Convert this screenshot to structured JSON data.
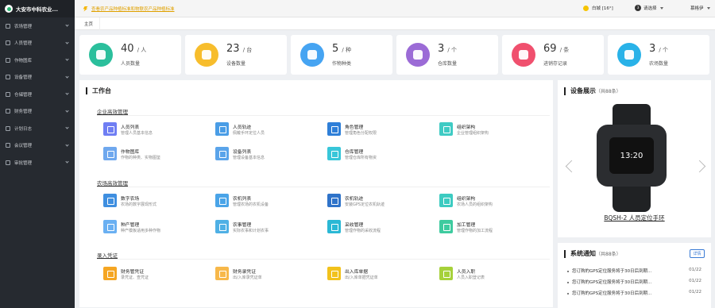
{
  "sidebar": {
    "brand": "大安市中科农业...",
    "items": [
      {
        "label": "农场管理",
        "icon": "farm-icon"
      },
      {
        "label": "人员管理",
        "icon": "people-icon"
      },
      {
        "label": "作物图库",
        "icon": "crop-icon"
      },
      {
        "label": "设备管理",
        "icon": "device-icon"
      },
      {
        "label": "仓储管理",
        "icon": "warehouse-icon"
      },
      {
        "label": "财务管理",
        "icon": "finance-icon"
      },
      {
        "label": "计划日志",
        "icon": "plan-icon"
      },
      {
        "label": "会议管理",
        "icon": "meeting-icon"
      },
      {
        "label": "审批管理",
        "icon": "approval-icon"
      }
    ]
  },
  "topbar": {
    "notice": "查看农产品种植标准和物联农产品种植标准",
    "weather": "白城 [16°]",
    "choose_num": "3",
    "choose_label": "请选择",
    "user": "慕格伊"
  },
  "tabs": [
    "主页"
  ],
  "stats": [
    {
      "value": "40",
      "unit": "/ 人",
      "label": "人员数量",
      "color": "#2bbf9c",
      "icon": "person-icon"
    },
    {
      "value": "23",
      "unit": "/ 台",
      "label": "设备数量",
      "color": "#f7bd2c",
      "icon": "tractor-icon"
    },
    {
      "value": "5",
      "unit": "/ 种",
      "label": "作物种类",
      "color": "#46a4f2",
      "icon": "sprout-icon"
    },
    {
      "value": "3",
      "unit": "/ 个",
      "label": "仓库数量",
      "color": "#9b6bd6",
      "icon": "warehouse-icon"
    },
    {
      "value": "69",
      "unit": "/ 条",
      "label": "进销存记录",
      "color": "#f0506e",
      "icon": "cart-icon"
    },
    {
      "value": "3",
      "unit": "/ 个",
      "label": "农场数量",
      "color": "#29b2e8",
      "icon": "field-icon"
    }
  ],
  "workbench": {
    "title": "工作台",
    "sections": [
      {
        "title": "企业高效管理",
        "modules": [
          {
            "title": "人员列表",
            "desc": "管理人员基本信息",
            "color": "#6f7ef3",
            "icon": "people-list-icon"
          },
          {
            "title": "人员轨迹",
            "desc": "佩戴手环定位人员",
            "color": "#4a9de6",
            "icon": "track-icon"
          },
          {
            "title": "角色管理",
            "desc": "管理角色分配权限",
            "color": "#2f7fd8",
            "icon": "role-icon"
          },
          {
            "title": "组织架构",
            "desc": "企业管理组织架构",
            "color": "#3fcbc4",
            "icon": "org-icon"
          },
          {
            "title": "作物图库",
            "desc": "作物的种类、实物图鉴",
            "color": "#6fa8ee",
            "icon": "leaf-icon"
          },
          {
            "title": "设备列表",
            "desc": "管理设备基本信息",
            "color": "#5aa4ea",
            "icon": "device-list-icon"
          },
          {
            "title": "仓库管理",
            "desc": "管理仓库所有物资",
            "color": "#38c6d9",
            "icon": "box-icon"
          }
        ]
      },
      {
        "title": "农场高效管理",
        "modules": [
          {
            "title": "数字农场",
            "desc": "农场的数字展现形式",
            "color": "#3f8fe0",
            "icon": "map-icon"
          },
          {
            "title": "农机列表",
            "desc": "管理农场的农机设备",
            "color": "#4aa4e8",
            "icon": "machine-icon"
          },
          {
            "title": "农机轨迹",
            "desc": "安装GPS定位农机轨迹",
            "color": "#2f73c9",
            "icon": "gps-icon"
          },
          {
            "title": "组织架构",
            "desc": "农场人员的组织架构",
            "color": "#3ccbc1",
            "icon": "org2-icon"
          },
          {
            "title": "种产管理",
            "desc": "种产模板适用多种作物",
            "color": "#6ab0f2",
            "icon": "chart-icon"
          },
          {
            "title": "农事管理",
            "desc": "实际农事和计划农事",
            "color": "#4fb0e5",
            "icon": "plant-icon"
          },
          {
            "title": "采收管理",
            "desc": "管理作物的采收流程",
            "color": "#2bb8d5",
            "icon": "basket-icon"
          },
          {
            "title": "加工管理",
            "desc": "管理作物的加工流程",
            "color": "#3ecb9f",
            "icon": "send-icon"
          }
        ]
      },
      {
        "title": "录入凭证",
        "modules": [
          {
            "title": "财务管凭证",
            "desc": "录凭证、查凭证",
            "color": "#f5a623",
            "icon": "voucher-icon"
          },
          {
            "title": "财务录凭证",
            "desc": "出/入库录凭证单",
            "color": "#f7b84a",
            "icon": "record-icon"
          },
          {
            "title": "出入库单据",
            "desc": "出/入库单据凭证单",
            "color": "#f2c21c",
            "icon": "pen-icon"
          },
          {
            "title": "人员入职",
            "desc": "人员入职登记表",
            "color": "#a6d13a",
            "icon": "check-icon"
          }
        ]
      }
    ]
  },
  "device_panel": {
    "title": "设备展示",
    "sub": "（共88条）",
    "watch_time": "13:20",
    "device_name": "BQSH-2 人员定位手环"
  },
  "notice_panel": {
    "title": "系统通知",
    "sub": "（共88条）",
    "more": "详情",
    "items": [
      {
        "text": "您订购的GPS定位服务将于30日后到期...",
        "date": "01/22"
      },
      {
        "text": "您订购的GPS定位服务将于30日后到期...",
        "date": "01/22"
      },
      {
        "text": "您订购的GPS定位服务将于30日后到期...",
        "date": "01/22"
      }
    ]
  }
}
